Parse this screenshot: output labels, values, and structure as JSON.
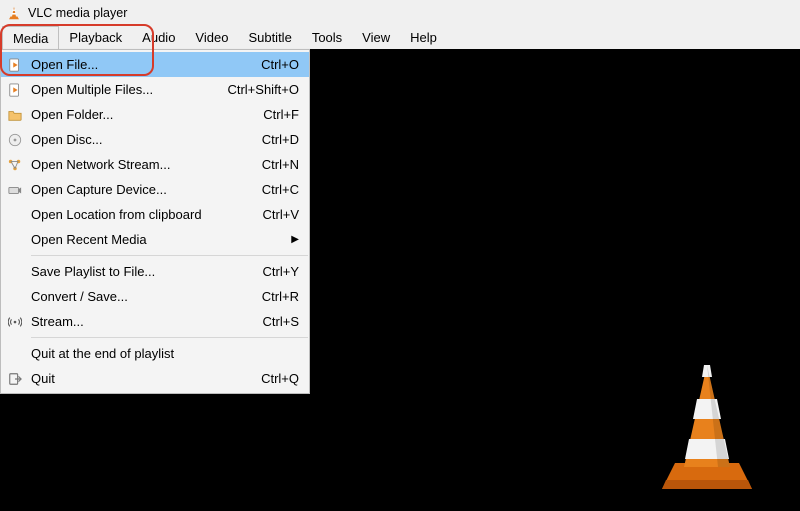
{
  "title": "VLC media player",
  "menubar": [
    "Media",
    "Playback",
    "Audio",
    "Video",
    "Subtitle",
    "Tools",
    "View",
    "Help"
  ],
  "media_menu": {
    "sections": [
      [
        {
          "icon": "file-play",
          "label": "Open File...",
          "shortcut": "Ctrl+O",
          "highlight": true
        },
        {
          "icon": "file-play",
          "label": "Open Multiple Files...",
          "shortcut": "Ctrl+Shift+O"
        },
        {
          "icon": "folder",
          "label": "Open Folder...",
          "shortcut": "Ctrl+F"
        },
        {
          "icon": "disc",
          "label": "Open Disc...",
          "shortcut": "Ctrl+D"
        },
        {
          "icon": "network",
          "label": "Open Network Stream...",
          "shortcut": "Ctrl+N"
        },
        {
          "icon": "capture",
          "label": "Open Capture Device...",
          "shortcut": "Ctrl+C"
        },
        {
          "icon": "",
          "label": "Open Location from clipboard",
          "shortcut": "Ctrl+V"
        },
        {
          "icon": "",
          "label": "Open Recent Media",
          "submenu": true
        }
      ],
      [
        {
          "icon": "",
          "label": "Save Playlist to File...",
          "shortcut": "Ctrl+Y"
        },
        {
          "icon": "",
          "label": "Convert / Save...",
          "shortcut": "Ctrl+R"
        },
        {
          "icon": "stream",
          "label": "Stream...",
          "shortcut": "Ctrl+S"
        }
      ],
      [
        {
          "icon": "",
          "label": "Quit at the end of playlist"
        },
        {
          "icon": "quit",
          "label": "Quit",
          "shortcut": "Ctrl+Q"
        }
      ]
    ]
  }
}
